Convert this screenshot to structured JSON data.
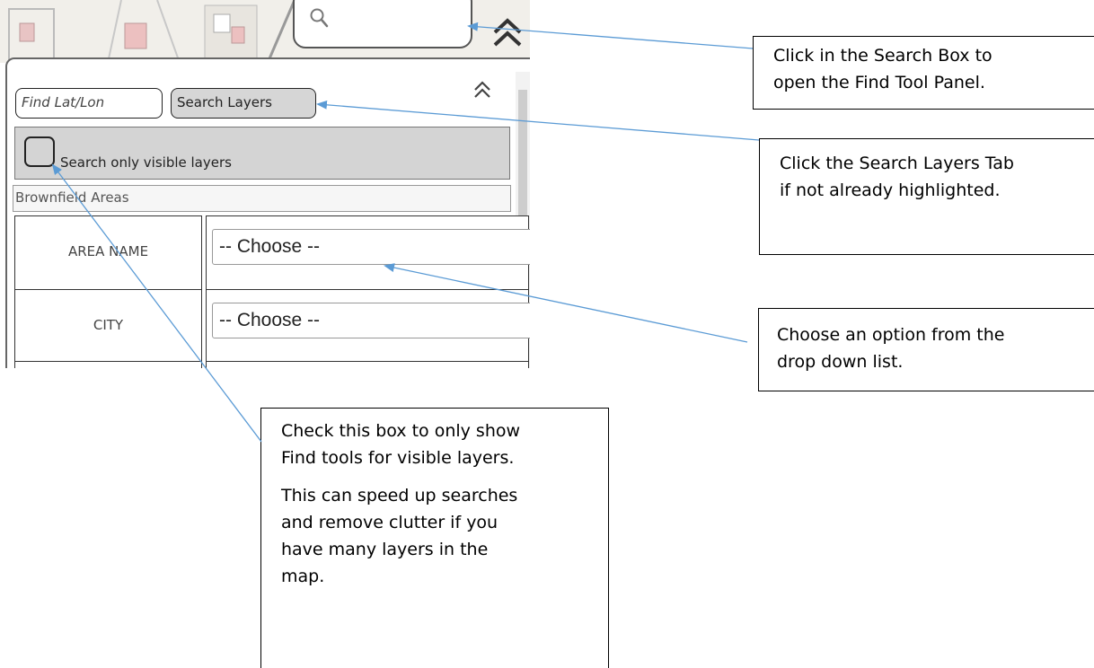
{
  "panel": {
    "tabs": {
      "find_lat_lon": "Find Lat/Lon",
      "search_layers": "Search Layers"
    },
    "visible_only_label": "Search only visible layers",
    "layer_title": "Brownfield Areas",
    "fields": [
      {
        "label": "AREA NAME",
        "value": "-- Choose --"
      },
      {
        "label": "CITY",
        "value": "-- Choose --"
      }
    ]
  },
  "callouts": {
    "search_box": {
      "line1": "Click in the Search Box to",
      "line2": "open the Find Tool Panel."
    },
    "search_layers_tab": {
      "line1": "Click the Search Layers Tab",
      "line2": "if not already highlighted."
    },
    "dropdown": {
      "line1": "Choose an option from the",
      "line2": "drop down list."
    },
    "visible_checkbox": {
      "p1_line1": "Check this box to only show",
      "p1_line2": "Find tools for visible layers.",
      "p2_line1": "This can speed up searches",
      "p2_line2": "and remove clutter if you",
      "p2_line3": "have many layers in the",
      "p2_line4": "map."
    }
  },
  "icons": {
    "search": "search-icon",
    "collapse": "chevron-double-up-icon"
  },
  "colors": {
    "arrow": "#5b9bd5",
    "tab_active": "#d6d6d6",
    "panel_row": "#d4d4d4"
  }
}
